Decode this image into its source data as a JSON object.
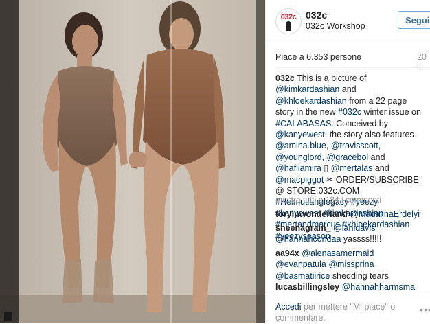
{
  "post": {
    "username": "032c",
    "location": "032c Workshop",
    "avatar_text": "032c",
    "follow_label": "Segui",
    "likes": "Piace a 6.353 persone",
    "time": "20 l",
    "caption": {
      "user": "032c",
      "t1": " This is a picture of ",
      "m1": "@kimkardashian",
      "t2": " and ",
      "m2": "@khloekardashian",
      "t3": " from a 22 page story in the new ",
      "h1": "#032c",
      "t4": " winter issue on ",
      "h2": "#CALABASAS",
      "t5": ". Conceived by ",
      "m3": "@kanyewest",
      "t6": ", the story also features ",
      "m4": "@amina.blue",
      "t7": ", ",
      "m5": "@travisscott",
      "t8": ", ",
      "m6": "@younglord",
      "t9": ", ",
      "m7": "@gracebol",
      "t10": " and ",
      "m8": "@hafiiamira",
      "t11": " ▯ ",
      "m9": "@mertalas",
      "t12": " and ",
      "m10": "@macpiggot",
      "t13": " ✂ ORDER/SUBSCRIBE @ STORE.032c.COM ",
      "h3": "#Helmutlanglegacy",
      "h4": "#yeezy",
      "h5": "#kanyewest",
      "h6": "#kimkardashian",
      "h7": "#mertandmarcus",
      "h8": "#khloekardashian",
      "h9": "#yeezyseason"
    },
    "more_comments": "mostra tutti e 184 i commenti",
    "comments": [
      {
        "user": "toryinwonderland",
        "mention": "@MadalinaErdelyi",
        "text": ""
      },
      {
        "user": "sheenagram_",
        "mention": "@lanidavis",
        "mention2": "@hannahcondaa",
        "text": " yassss!!!!!"
      },
      {
        "user": "aa94x",
        "mention": "@alenasamermaid",
        "mention2": "@evanpatula",
        "mention3": "@missprina",
        "mention4": "@basmatiirice",
        "text": " shedding tears"
      },
      {
        "user": "lucasbillingsley",
        "mention": "@hannahharmsma",
        "text": ""
      }
    ],
    "login_link": "Accedi",
    "login_text": " per mettere \"Mi piace\" o commentare.",
    "more_dots": "•••"
  }
}
